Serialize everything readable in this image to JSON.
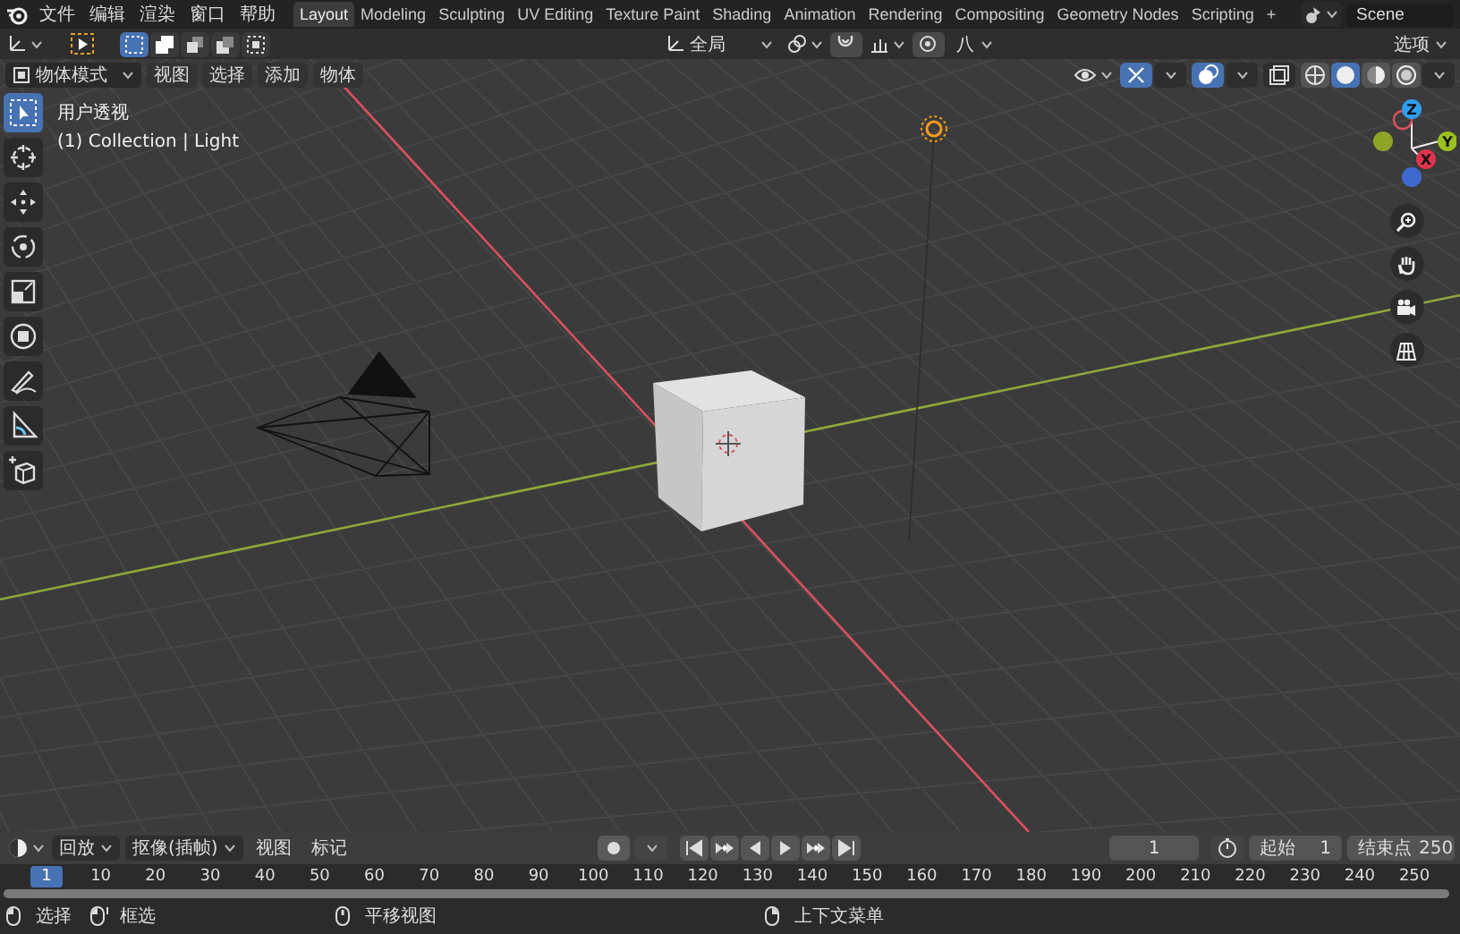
{
  "menu_bar": {
    "menus": [
      "文件",
      "编辑",
      "渲染",
      "窗口",
      "帮助"
    ],
    "workspaces": [
      {
        "label": "Layout",
        "selected": true
      },
      {
        "label": "Modeling",
        "selected": false
      },
      {
        "label": "Sculpting",
        "selected": false
      },
      {
        "label": "UV Editing",
        "selected": false
      },
      {
        "label": "Texture Paint",
        "selected": false
      },
      {
        "label": "Shading",
        "selected": false
      },
      {
        "label": "Animation",
        "selected": false
      },
      {
        "label": "Rendering",
        "selected": false
      },
      {
        "label": "Compositing",
        "selected": false
      },
      {
        "label": "Geometry Nodes",
        "selected": false
      },
      {
        "label": "Scripting",
        "selected": false
      }
    ],
    "add_tab": "+",
    "scene": "Scene"
  },
  "tool_header": {
    "select_modes": [
      {
        "selected": true
      },
      {
        "selected": false
      },
      {
        "selected": false
      },
      {
        "selected": false
      },
      {
        "selected": false
      }
    ],
    "transform_orientation": "全局",
    "proportional": "八",
    "options": "选项"
  },
  "viewport_header": {
    "mode": "物体模式",
    "menus": [
      "视图",
      "选择",
      "添加",
      "物体"
    ],
    "shading": [
      {
        "kind": "wireframe",
        "selected": false
      },
      {
        "kind": "solid",
        "selected": true
      },
      {
        "kind": "material",
        "selected": false
      },
      {
        "kind": "rendered",
        "selected": false
      }
    ]
  },
  "viewport": {
    "view_name": "用户透视",
    "object_info": "(1) Collection | Light",
    "tools": [
      {
        "kind": "select",
        "selected": true
      },
      {
        "kind": "cursor",
        "selected": false
      },
      {
        "kind": "move",
        "selected": false
      },
      {
        "kind": "rotate",
        "selected": false
      },
      {
        "kind": "scale",
        "selected": false
      },
      {
        "kind": "transform",
        "selected": false
      },
      {
        "kind": "annotate",
        "selected": false
      },
      {
        "kind": "measure",
        "selected": false
      },
      {
        "kind": "add-cube",
        "selected": false
      }
    ],
    "gizmo": {
      "z": "Z",
      "y": "Y",
      "x": "X"
    }
  },
  "timeline": {
    "menus": [
      "回放",
      "抠像(插帧)",
      "视图",
      "标记"
    ],
    "current_frame": "1",
    "start_label": "起始",
    "start": "1",
    "end_label": "结束点",
    "end": "250",
    "ruler": [
      {
        "label": "1",
        "selected": true
      },
      {
        "label": "10",
        "selected": false
      },
      {
        "label": "20",
        "selected": false
      },
      {
        "label": "30",
        "selected": false
      },
      {
        "label": "40",
        "selected": false
      },
      {
        "label": "50",
        "selected": false
      },
      {
        "label": "60",
        "selected": false
      },
      {
        "label": "70",
        "selected": false
      },
      {
        "label": "80",
        "selected": false
      },
      {
        "label": "90",
        "selected": false
      },
      {
        "label": "100",
        "selected": false
      },
      {
        "label": "110",
        "selected": false
      },
      {
        "label": "120",
        "selected": false
      },
      {
        "label": "130",
        "selected": false
      },
      {
        "label": "140",
        "selected": false
      },
      {
        "label": "150",
        "selected": false
      },
      {
        "label": "160",
        "selected": false
      },
      {
        "label": "170",
        "selected": false
      },
      {
        "label": "180",
        "selected": false
      },
      {
        "label": "190",
        "selected": false
      },
      {
        "label": "200",
        "selected": false
      },
      {
        "label": "210",
        "selected": false
      },
      {
        "label": "220",
        "selected": false
      },
      {
        "label": "230",
        "selected": false
      },
      {
        "label": "240",
        "selected": false
      },
      {
        "label": "250",
        "selected": false
      }
    ]
  },
  "status_bar": [
    {
      "kind": "left",
      "label": "选择"
    },
    {
      "kind": "drag",
      "label": "框选"
    },
    {
      "kind": "middle",
      "label": "平移视图"
    },
    {
      "kind": "right",
      "label": "上下文菜单"
    }
  ]
}
